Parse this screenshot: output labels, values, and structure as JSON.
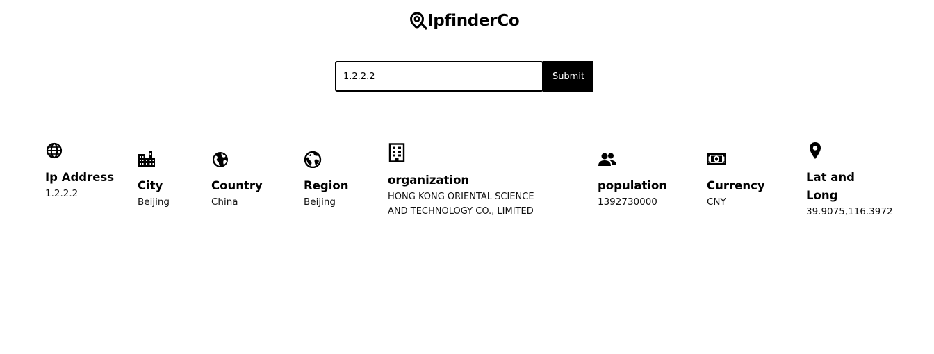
{
  "brand": {
    "icon": "map-pin-search-icon",
    "name": "IpfinderCo"
  },
  "search": {
    "value": "1.2.2.2",
    "submit_label": "Submit"
  },
  "info_cards": [
    {
      "icon": "globe-grid-icon",
      "label": "Ip Address",
      "value": "1.2.2.2"
    },
    {
      "icon": "city-buildings-icon",
      "label": "City",
      "value": "Beijing"
    },
    {
      "icon": "globe-americas-icon",
      "label": "Country",
      "value": "China"
    },
    {
      "icon": "globe-outline-icon",
      "label": "Region",
      "value": "Beijing"
    },
    {
      "icon": "office-building-icon",
      "label": "organization",
      "value": "HONG KONG ORIENTAL SCIENCE AND TECHNOLOGY CO., LIMITED"
    },
    {
      "icon": "people-icon",
      "label": "population",
      "value": "1392730000"
    },
    {
      "icon": "banknote-icon",
      "label": "Currency",
      "value": "CNY"
    },
    {
      "icon": "location-pin-icon",
      "label": "Lat and Long",
      "value": "39.9075,116.3972"
    }
  ]
}
